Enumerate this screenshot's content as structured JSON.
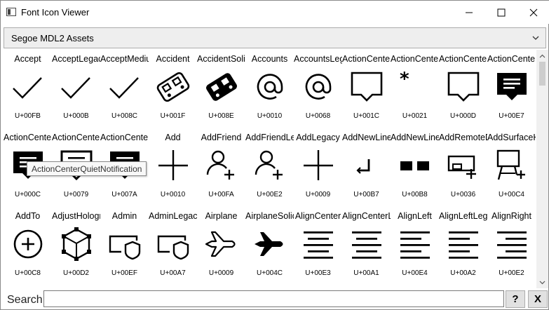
{
  "window": {
    "title": "Font Icon Viewer",
    "minimize_icon": "minimize-icon",
    "maximize_icon": "maximize-icon",
    "close_icon": "close-icon"
  },
  "font_select": {
    "selected": "Segoe MDL2 Assets"
  },
  "glyphs": [
    {
      "name": "Accept",
      "code": "U+00FB",
      "icon": "checkmark"
    },
    {
      "name": "AcceptLegacy",
      "code": "U+000B",
      "icon": "checkmark"
    },
    {
      "name": "AcceptMedium",
      "code": "U+008C",
      "icon": "checkmark"
    },
    {
      "name": "Accident",
      "code": "U+001F",
      "icon": "accident"
    },
    {
      "name": "AccidentSolid",
      "code": "U+008E",
      "icon": "accident-solid"
    },
    {
      "name": "Accounts",
      "code": "U+0010",
      "icon": "at-sign"
    },
    {
      "name": "AccountsLegacy",
      "code": "U+0068",
      "icon": "at-sign"
    },
    {
      "name": "ActionCenter",
      "code": "U+001C",
      "icon": "speech-bubble"
    },
    {
      "name": "ActionCenterAsterisk",
      "code": "U+0021",
      "icon": "asterisk"
    },
    {
      "name": "ActionCenterLegacy",
      "code": "U+000D",
      "icon": "speech-bubble"
    },
    {
      "name": "ActionCenterNotification",
      "code": "U+00E7",
      "icon": "speech-bubble-solid-lines"
    },
    {
      "name": "ActionCenterMirrored",
      "code": "U+000C",
      "icon": "speech-bubble-solid-lines"
    },
    {
      "name": "ActionCenterNotificationMirrored",
      "code": "U+0079",
      "icon": "speech-bubble-lines"
    },
    {
      "name": "ActionCenterQuietNotification",
      "code": "U+007A",
      "icon": "speech-bubble-solid-lines"
    },
    {
      "name": "Add",
      "code": "U+0010",
      "icon": "plus"
    },
    {
      "name": "AddFriend",
      "code": "U+00FA",
      "icon": "person-add"
    },
    {
      "name": "AddFriendLegacy",
      "code": "U+00E2",
      "icon": "person-add"
    },
    {
      "name": "AddLegacy",
      "code": "U+0009",
      "icon": "plus"
    },
    {
      "name": "AddNewLine",
      "code": "U+00B7",
      "icon": "new-line"
    },
    {
      "name": "AddNewLineFill",
      "code": "U+00B8",
      "icon": "two-blocks"
    },
    {
      "name": "AddRemoteDevice",
      "code": "U+0036",
      "icon": "remote-device"
    },
    {
      "name": "AddSurfaceHub",
      "code": "U+00C4",
      "icon": "surface-hub"
    },
    {
      "name": "AddTo",
      "code": "U+00C8",
      "icon": "circle-plus"
    },
    {
      "name": "AdjustHologram",
      "code": "U+00D2",
      "icon": "cube"
    },
    {
      "name": "Admin",
      "code": "U+00EF",
      "icon": "admin-shield"
    },
    {
      "name": "AdminLegacy",
      "code": "U+00A7",
      "icon": "admin-shield"
    },
    {
      "name": "Airplane",
      "code": "U+0009",
      "icon": "airplane"
    },
    {
      "name": "AirplaneSolid",
      "code": "U+004C",
      "icon": "airplane-solid"
    },
    {
      "name": "AlignCenter",
      "code": "U+00E3",
      "icon": "align-center"
    },
    {
      "name": "AlignCenterLegacy",
      "code": "U+00A1",
      "icon": "align-center"
    },
    {
      "name": "AlignLeft",
      "code": "U+00E4",
      "icon": "align-left"
    },
    {
      "name": "AlignLeftLegacy",
      "code": "U+00A2",
      "icon": "align-left"
    },
    {
      "name": "AlignRight",
      "code": "U+00E2",
      "icon": "align-right"
    }
  ],
  "tooltip": {
    "text": "ActionCenterQuietNotification"
  },
  "search": {
    "label": "Search",
    "value": "",
    "help_label": "?",
    "clear_label": "X"
  },
  "scrollbar": {
    "up_icon": "scroll-up-arrow-icon",
    "down_icon": "scroll-down-arrow-icon"
  }
}
